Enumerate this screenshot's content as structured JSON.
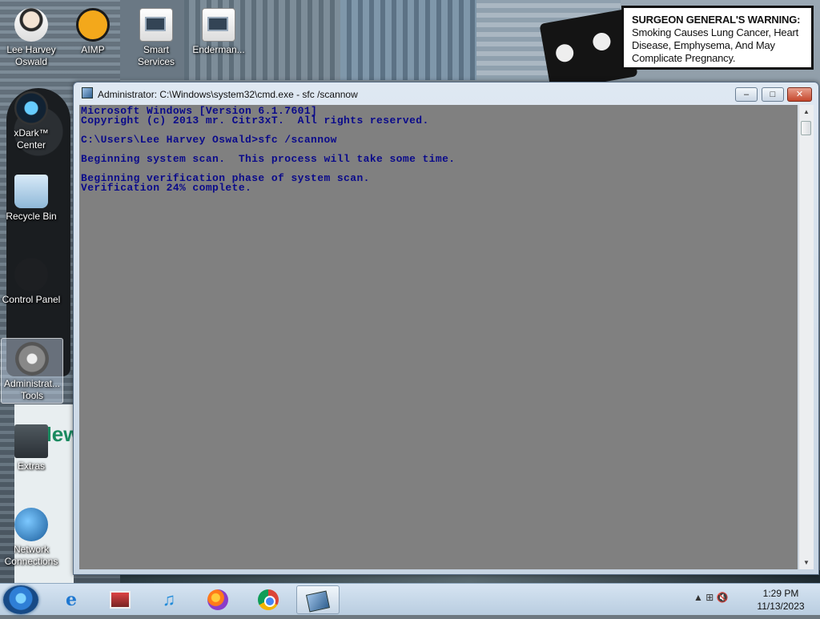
{
  "warning": {
    "heading": "SURGEON GENERAL'S WARNING:",
    "text": "Smoking Causes Lung Cancer, Heart Disease, Emphysema, And May Complicate Pregnancy."
  },
  "desktop_icons": [
    {
      "label": "Lee Harvey Oswald",
      "icon": "person-icon"
    },
    {
      "label": "AIMP",
      "icon": "aimp-icon"
    },
    {
      "label": "Smart Services",
      "icon": "services-icon"
    },
    {
      "label": "Enderman...",
      "icon": "app-icon"
    },
    {
      "label": "xDark™ Center",
      "icon": "xdark-icon"
    },
    {
      "label": "Recycle Bin",
      "icon": "recycle-bin-icon"
    },
    {
      "label": "Control Panel",
      "icon": "control-panel-icon"
    },
    {
      "label": "Administrat... Tools",
      "icon": "admin-tools-icon"
    },
    {
      "label": "Extras",
      "icon": "safe-icon"
    },
    {
      "label": "Network Connections",
      "icon": "network-icon"
    }
  ],
  "cmd": {
    "title": "Administrator: C:\\Windows\\system32\\cmd.exe - sfc  /scannow",
    "minimize": "–",
    "maximize": "□",
    "close": "✕",
    "lines": [
      "Microsoft Windows [Version 6.1.7601]",
      "Copyright (c) 2013 mr. Citr3xT.  All rights reserved.",
      "",
      "C:\\Users\\Lee Harvey Oswald>sfc /scannow",
      "",
      "Beginning system scan.  This process will take some time.",
      "",
      "Beginning verification phase of system scan.",
      "Verification 24% complete."
    ]
  },
  "taskbar": {
    "apps": [
      "start-orb",
      "internet-explorer",
      "media-center",
      "itunes",
      "firefox",
      "chrome",
      "cmd"
    ],
    "time": "1:29 PM",
    "date": "11/13/2023",
    "tray_glyphs": "▲  ⊞  🔇"
  }
}
